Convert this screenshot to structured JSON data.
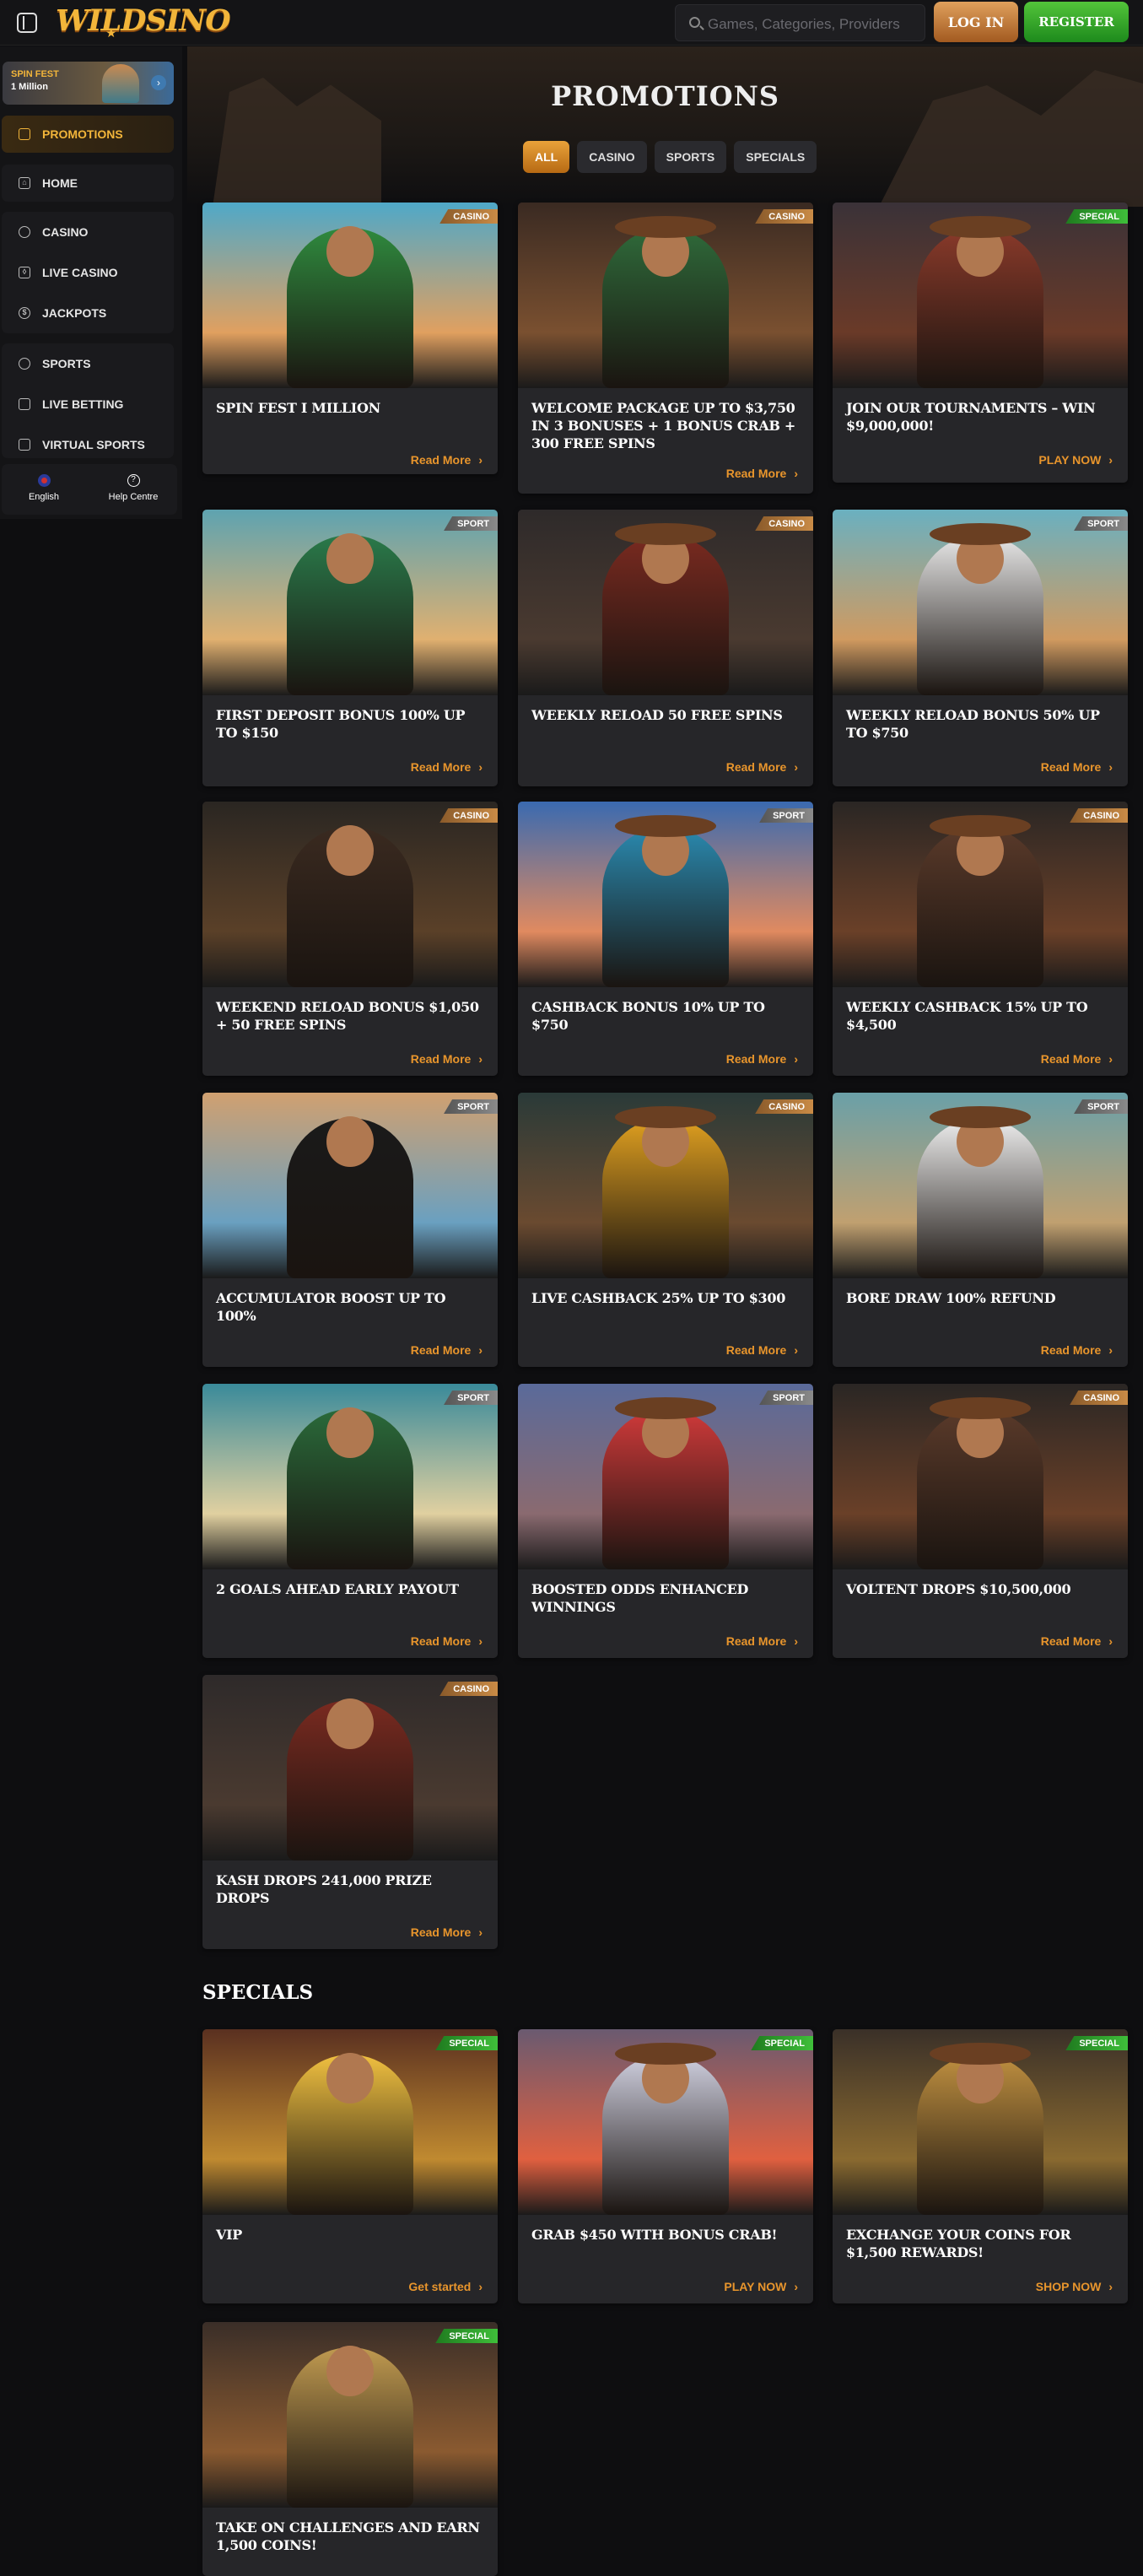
{
  "header": {
    "logo": "WILDSINO",
    "search_placeholder": "Games, Categories, Providers",
    "login": "LOG IN",
    "register": "REGISTER"
  },
  "sidebar": {
    "banner": {
      "line1": "SPIN FEST",
      "line2": "1 Million"
    },
    "items": [
      {
        "label": "PROMOTIONS",
        "icon": "gift-icon"
      },
      {
        "label": "HOME",
        "icon": "home-icon"
      },
      {
        "label": "CASINO",
        "icon": "casino-chip-icon"
      },
      {
        "label": "LIVE CASINO",
        "icon": "live-icon"
      },
      {
        "label": "JACKPOTS",
        "icon": "jackpot-icon"
      },
      {
        "label": "SPORTS",
        "icon": "football-icon"
      },
      {
        "label": "LIVE BETTING",
        "icon": "live-betting-icon"
      },
      {
        "label": "VIRTUAL SPORTS",
        "icon": "virtual-sports-icon"
      }
    ],
    "language": "English",
    "help": "Help Centre"
  },
  "page": {
    "title": "PROMOTIONS",
    "filters": [
      "ALL",
      "CASINO",
      "SPORTS",
      "SPECIALS"
    ],
    "active_filter": "ALL"
  },
  "promotions": [
    {
      "title": "SPIN FEST I MILLION",
      "tag": "CASINO",
      "cta": "Read More"
    },
    {
      "title": "WELCOME PACKAGE UP TO $3,750 IN 3 BONUSES + 1 BONUS CRAB + 300 FREE SPINS",
      "tag": "CASINO",
      "cta": "Read More"
    },
    {
      "title": "JOIN OUR TOURNAMENTS – WIN $9,000,000!",
      "tag": "SPECIAL",
      "cta": "PLAY NOW"
    },
    {
      "title": "FIRST DEPOSIT BONUS 100% UP TO $150",
      "tag": "SPORT",
      "cta": "Read More"
    },
    {
      "title": "WEEKLY RELOAD 50 FREE SPINS",
      "tag": "CASINO",
      "cta": "Read More"
    },
    {
      "title": "WEEKLY RELOAD BONUS 50% UP TO $750",
      "tag": "SPORT",
      "cta": "Read More"
    },
    {
      "title": "WEEKEND RELOAD BONUS $1,050 + 50 FREE SPINS",
      "tag": "CASINO",
      "cta": "Read More"
    },
    {
      "title": "CASHBACK BONUS 10% UP TO $750",
      "tag": "SPORT",
      "cta": "Read More"
    },
    {
      "title": "WEEKLY CASHBACK 15% UP TO $4,500",
      "tag": "CASINO",
      "cta": "Read More"
    },
    {
      "title": "ACCUMULATOR BOOST UP TO 100%",
      "tag": "SPORT",
      "cta": "Read More"
    },
    {
      "title": "LIVE CASHBACK 25% UP TO $300",
      "tag": "CASINO",
      "cta": "Read More"
    },
    {
      "title": "BORE DRAW 100% REFUND",
      "tag": "SPORT",
      "cta": "Read More"
    },
    {
      "title": "2 GOALS AHEAD EARLY PAYOUT",
      "tag": "SPORT",
      "cta": "Read More"
    },
    {
      "title": "BOOSTED ODDS ENHANCED WINNINGS",
      "tag": "SPORT",
      "cta": "Read More"
    },
    {
      "title": "VOLTENT DROPS $10,500,000",
      "tag": "CASINO",
      "cta": "Read More"
    },
    {
      "title": "KASH DROPS 241,000 PRIZE DROPS",
      "tag": "CASINO",
      "cta": "Read More"
    }
  ],
  "specials": {
    "title": "SPECIALS",
    "items": [
      {
        "title": "VIP",
        "tag": "SPECIAL",
        "cta": "Get started"
      },
      {
        "title": "GRAB $450 WITH BONUS CRAB!",
        "tag": "SPECIAL",
        "cta": "PLAY NOW"
      },
      {
        "title": "EXCHANGE YOUR COINS FOR $1,500 REWARDS!",
        "tag": "SPECIAL",
        "cta": "SHOP NOW"
      },
      {
        "title": "TAKE ON CHALLENGES AND EARN 1,500 COINS!",
        "tag": "SPECIAL",
        "cta": ""
      }
    ]
  },
  "colors": {
    "accent": "#e8952c",
    "register": "#3fb22e",
    "background": "#0e0e10",
    "card": "#262629"
  }
}
